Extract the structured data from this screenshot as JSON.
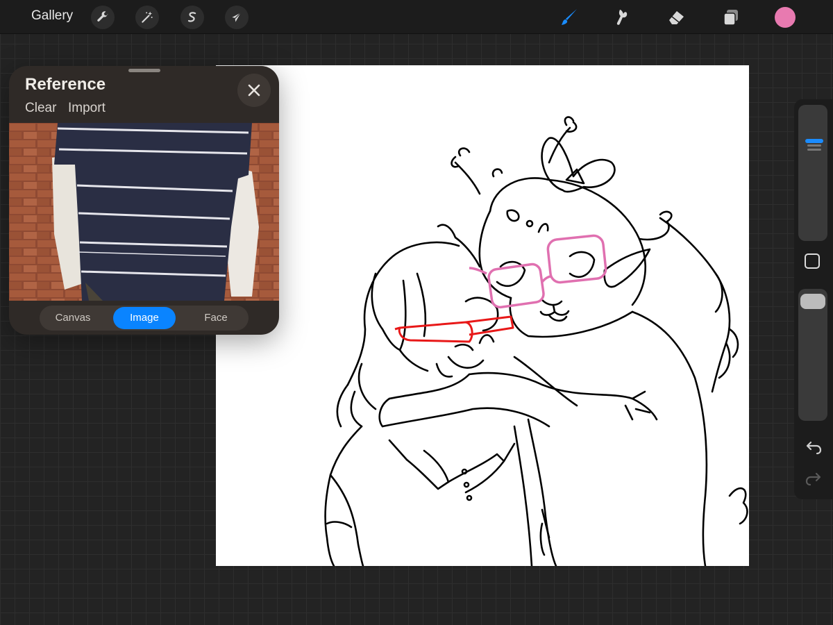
{
  "toolbar": {
    "gallery_label": "Gallery",
    "actions_icon": "wrench-icon",
    "adjustments_icon": "magic-wand-icon",
    "selection_icon": "selection-s-icon",
    "transform_icon": "arrow-cursor-icon",
    "brush_icon": "brush-icon",
    "smudge_icon": "smudge-icon",
    "eraser_icon": "eraser-icon",
    "layers_icon": "layers-icon",
    "active_tool": "brush",
    "active_color": "#e87ab0",
    "accent_color": "#1a8cff"
  },
  "reference": {
    "title": "Reference",
    "clear_label": "Clear",
    "import_label": "Import",
    "tabs": [
      {
        "label": "Canvas",
        "active": false
      },
      {
        "label": "Image",
        "active": true
      },
      {
        "label": "Face",
        "active": false
      }
    ],
    "tab_active_color": "#0a84ff"
  },
  "sidebar": {
    "brush_size_level": 0.25,
    "opacity_level": 0.02
  }
}
